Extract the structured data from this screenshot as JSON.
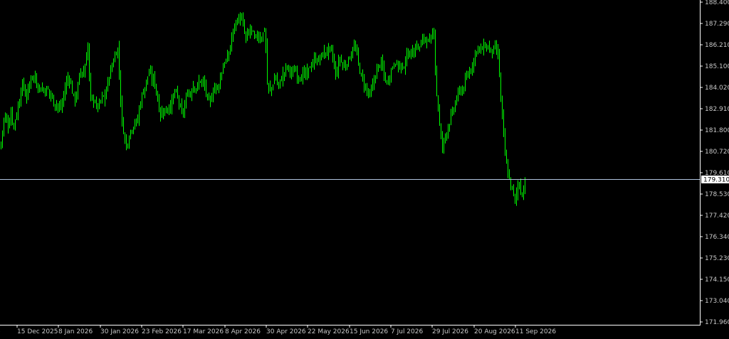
{
  "colors": {
    "background": "#000000",
    "candle": "#00ff00",
    "axis": "#ffffff",
    "tick_text": "#c8c8c8",
    "price_line": "#b0c4de",
    "price_box": "#ffffff"
  },
  "chart_data": {
    "type": "candlestick",
    "title": "",
    "current_price": 179.31,
    "current_price_label": "179.310",
    "ylim": [
      171.96,
      188.4
    ],
    "y_ticks": [
      "188.400",
      "187.290",
      "186.210",
      "185.100",
      "184.020",
      "182.910",
      "181.800",
      "180.720",
      "179.610",
      "178.530",
      "177.420",
      "176.340",
      "175.230",
      "174.150",
      "173.040",
      "171.960"
    ],
    "x_ticks": [
      "2025",
      "15 Dec 2025",
      "8 Jan 2026",
      "30 Jan 2026",
      "23 Feb 2026",
      "17 Mar 2026",
      "8 Apr 2026",
      "30 Apr 2026",
      "22 May 2026",
      "15 Jun 2026",
      "7 Jul 2026",
      "29 Jul 2026",
      "20 Aug 2026",
      "11 Sep 2026"
    ],
    "close_path": [
      [
        0,
        180.9
      ],
      [
        3,
        181.8
      ],
      [
        6,
        182.6
      ],
      [
        9,
        182.3
      ],
      [
        12,
        182.0
      ],
      [
        15,
        182.8
      ],
      [
        18,
        182.0
      ],
      [
        21,
        182.4
      ],
      [
        24,
        182.8
      ],
      [
        27,
        183.4
      ],
      [
        30,
        184.2
      ],
      [
        33,
        184.0
      ],
      [
        36,
        183.5
      ],
      [
        39,
        183.8
      ],
      [
        42,
        184.4
      ],
      [
        45,
        184.7
      ],
      [
        48,
        184.5
      ],
      [
        51,
        184.2
      ],
      [
        54,
        184.1
      ],
      [
        57,
        183.9
      ],
      [
        60,
        184.0
      ],
      [
        63,
        183.8
      ],
      [
        66,
        184.0
      ],
      [
        69,
        183.7
      ],
      [
        72,
        183.6
      ],
      [
        75,
        183.2
      ],
      [
        78,
        183.3
      ],
      [
        81,
        183.0
      ],
      [
        84,
        182.9
      ],
      [
        87,
        183.2
      ],
      [
        90,
        183.8
      ],
      [
        93,
        184.3
      ],
      [
        96,
        184.6
      ],
      [
        99,
        184.2
      ],
      [
        102,
        183.6
      ],
      [
        105,
        183.4
      ],
      [
        108,
        183.8
      ],
      [
        111,
        184.6
      ],
      [
        114,
        185.0
      ],
      [
        117,
        184.6
      ],
      [
        120,
        185.4
      ],
      [
        123,
        186.2
      ],
      [
        126,
        183.6
      ],
      [
        129,
        183.3
      ],
      [
        132,
        183.5
      ],
      [
        135,
        183.0
      ],
      [
        138,
        183.1
      ],
      [
        141,
        183.3
      ],
      [
        144,
        183.6
      ],
      [
        147,
        183.4
      ],
      [
        150,
        184.2
      ],
      [
        153,
        184.6
      ],
      [
        156,
        185.0
      ],
      [
        159,
        185.4
      ],
      [
        162,
        185.8
      ],
      [
        165,
        186.0
      ],
      [
        168,
        184.1
      ],
      [
        171,
        182.2
      ],
      [
        174,
        181.6
      ],
      [
        177,
        181.0
      ],
      [
        180,
        181.4
      ],
      [
        183,
        181.8
      ],
      [
        186,
        182.0
      ],
      [
        189,
        182.3
      ],
      [
        192,
        182.1
      ],
      [
        195,
        182.9
      ],
      [
        198,
        183.5
      ],
      [
        201,
        183.8
      ],
      [
        204,
        184.2
      ],
      [
        207,
        184.6
      ],
      [
        210,
        184.8
      ],
      [
        213,
        184.4
      ],
      [
        216,
        184.5
      ],
      [
        219,
        183.8
      ],
      [
        222,
        183.2
      ],
      [
        225,
        182.6
      ],
      [
        228,
        182.8
      ],
      [
        231,
        182.9
      ],
      [
        234,
        182.7
      ],
      [
        237,
        183.2
      ],
      [
        240,
        183.0
      ],
      [
        243,
        183.6
      ],
      [
        246,
        183.8
      ],
      [
        249,
        183.5
      ],
      [
        252,
        183.1
      ],
      [
        255,
        182.6
      ],
      [
        258,
        182.9
      ],
      [
        261,
        183.4
      ],
      [
        264,
        183.9
      ],
      [
        267,
        183.6
      ],
      [
        270,
        184.2
      ],
      [
        273,
        184.1
      ],
      [
        276,
        183.9
      ],
      [
        279,
        184.3
      ],
      [
        282,
        184.4
      ],
      [
        285,
        184.2
      ],
      [
        288,
        184.0
      ],
      [
        291,
        183.4
      ],
      [
        294,
        183.1
      ],
      [
        297,
        183.6
      ],
      [
        300,
        184.0
      ],
      [
        303,
        184.1
      ],
      [
        306,
        184.0
      ],
      [
        309,
        184.5
      ],
      [
        312,
        185.0
      ],
      [
        315,
        185.3
      ],
      [
        318,
        185.4
      ],
      [
        321,
        185.7
      ],
      [
        324,
        186.4
      ],
      [
        327,
        186.9
      ],
      [
        330,
        187.3
      ],
      [
        333,
        187.5
      ],
      [
        336,
        187.6
      ],
      [
        339,
        187.5
      ],
      [
        342,
        187.0
      ],
      [
        345,
        186.5
      ],
      [
        348,
        186.7
      ],
      [
        351,
        187.1
      ],
      [
        354,
        186.8
      ],
      [
        357,
        186.5
      ],
      [
        360,
        186.6
      ],
      [
        363,
        186.7
      ],
      [
        366,
        186.5
      ],
      [
        369,
        186.8
      ],
      [
        372,
        187.1
      ],
      [
        375,
        184.2
      ],
      [
        378,
        183.8
      ],
      [
        381,
        184.0
      ],
      [
        384,
        184.3
      ],
      [
        387,
        184.6
      ],
      [
        390,
        184.0
      ],
      [
        393,
        184.3
      ],
      [
        396,
        184.6
      ],
      [
        399,
        184.8
      ],
      [
        402,
        185.1
      ],
      [
        405,
        185.0
      ],
      [
        408,
        184.8
      ],
      [
        411,
        184.7
      ],
      [
        414,
        185.0
      ],
      [
        417,
        184.6
      ],
      [
        420,
        184.7
      ],
      [
        423,
        184.5
      ],
      [
        426,
        184.8
      ],
      [
        429,
        184.6
      ],
      [
        432,
        184.8
      ],
      [
        435,
        185.1
      ],
      [
        438,
        185.2
      ],
      [
        441,
        185.4
      ],
      [
        444,
        185.5
      ],
      [
        447,
        185.4
      ],
      [
        450,
        185.6
      ],
      [
        453,
        185.7
      ],
      [
        456,
        185.8
      ],
      [
        459,
        185.9
      ],
      [
        462,
        186.0
      ],
      [
        465,
        185.8
      ],
      [
        468,
        185.4
      ],
      [
        471,
        184.6
      ],
      [
        474,
        185.1
      ],
      [
        477,
        185.5
      ],
      [
        480,
        185.3
      ],
      [
        483,
        185.0
      ],
      [
        486,
        185.3
      ],
      [
        489,
        185.4
      ],
      [
        492,
        185.7
      ],
      [
        495,
        186.0
      ],
      [
        498,
        186.1
      ],
      [
        501,
        185.7
      ],
      [
        504,
        185.0
      ],
      [
        507,
        184.6
      ],
      [
        510,
        184.3
      ],
      [
        513,
        184.0
      ],
      [
        516,
        183.8
      ],
      [
        519,
        183.6
      ],
      [
        522,
        183.9
      ],
      [
        525,
        184.4
      ],
      [
        528,
        184.8
      ],
      [
        531,
        185.1
      ],
      [
        534,
        185.3
      ],
      [
        537,
        185.0
      ],
      [
        540,
        184.5
      ],
      [
        543,
        184.2
      ],
      [
        546,
        184.6
      ],
      [
        549,
        184.9
      ],
      [
        552,
        185.2
      ],
      [
        555,
        185.4
      ],
      [
        558,
        185.0
      ],
      [
        561,
        185.3
      ],
      [
        564,
        184.8
      ],
      [
        567,
        185.2
      ],
      [
        570,
        185.5
      ],
      [
        573,
        185.7
      ],
      [
        576,
        185.9
      ],
      [
        579,
        185.7
      ],
      [
        582,
        186.0
      ],
      [
        585,
        186.2
      ],
      [
        588,
        186.0
      ],
      [
        591,
        186.3
      ],
      [
        594,
        186.5
      ],
      [
        597,
        186.6
      ],
      [
        600,
        186.4
      ],
      [
        603,
        186.3
      ],
      [
        606,
        186.5
      ],
      [
        609,
        187.1
      ],
      [
        612,
        184.0
      ],
      [
        615,
        183.0
      ],
      [
        618,
        181.6
      ],
      [
        621,
        181.0
      ],
      [
        624,
        181.4
      ],
      [
        627,
        181.8
      ],
      [
        630,
        182.1
      ],
      [
        633,
        182.5
      ],
      [
        636,
        182.8
      ],
      [
        639,
        183.2
      ],
      [
        642,
        183.6
      ],
      [
        645,
        183.8
      ],
      [
        648,
        183.9
      ],
      [
        651,
        184.0
      ],
      [
        654,
        184.4
      ],
      [
        657,
        184.7
      ],
      [
        660,
        184.9
      ],
      [
        663,
        185.2
      ],
      [
        666,
        185.6
      ],
      [
        669,
        186.0
      ],
      [
        672,
        186.1
      ],
      [
        675,
        185.9
      ],
      [
        678,
        186.0
      ],
      [
        681,
        186.2
      ],
      [
        684,
        186.0
      ],
      [
        687,
        186.1
      ],
      [
        690,
        185.8
      ],
      [
        693,
        186.0
      ],
      [
        696,
        185.9
      ],
      [
        699,
        185.8
      ],
      [
        702,
        184.0
      ],
      [
        705,
        182.5
      ],
      [
        708,
        181.0
      ],
      [
        711,
        180.0
      ],
      [
        714,
        179.4
      ],
      [
        717,
        179.0
      ],
      [
        720,
        178.6
      ],
      [
        723,
        178.2
      ],
      [
        726,
        178.8
      ],
      [
        729,
        179.2
      ],
      [
        732,
        178.4
      ],
      [
        735,
        178.8
      ],
      [
        738,
        179.3
      ]
    ]
  }
}
